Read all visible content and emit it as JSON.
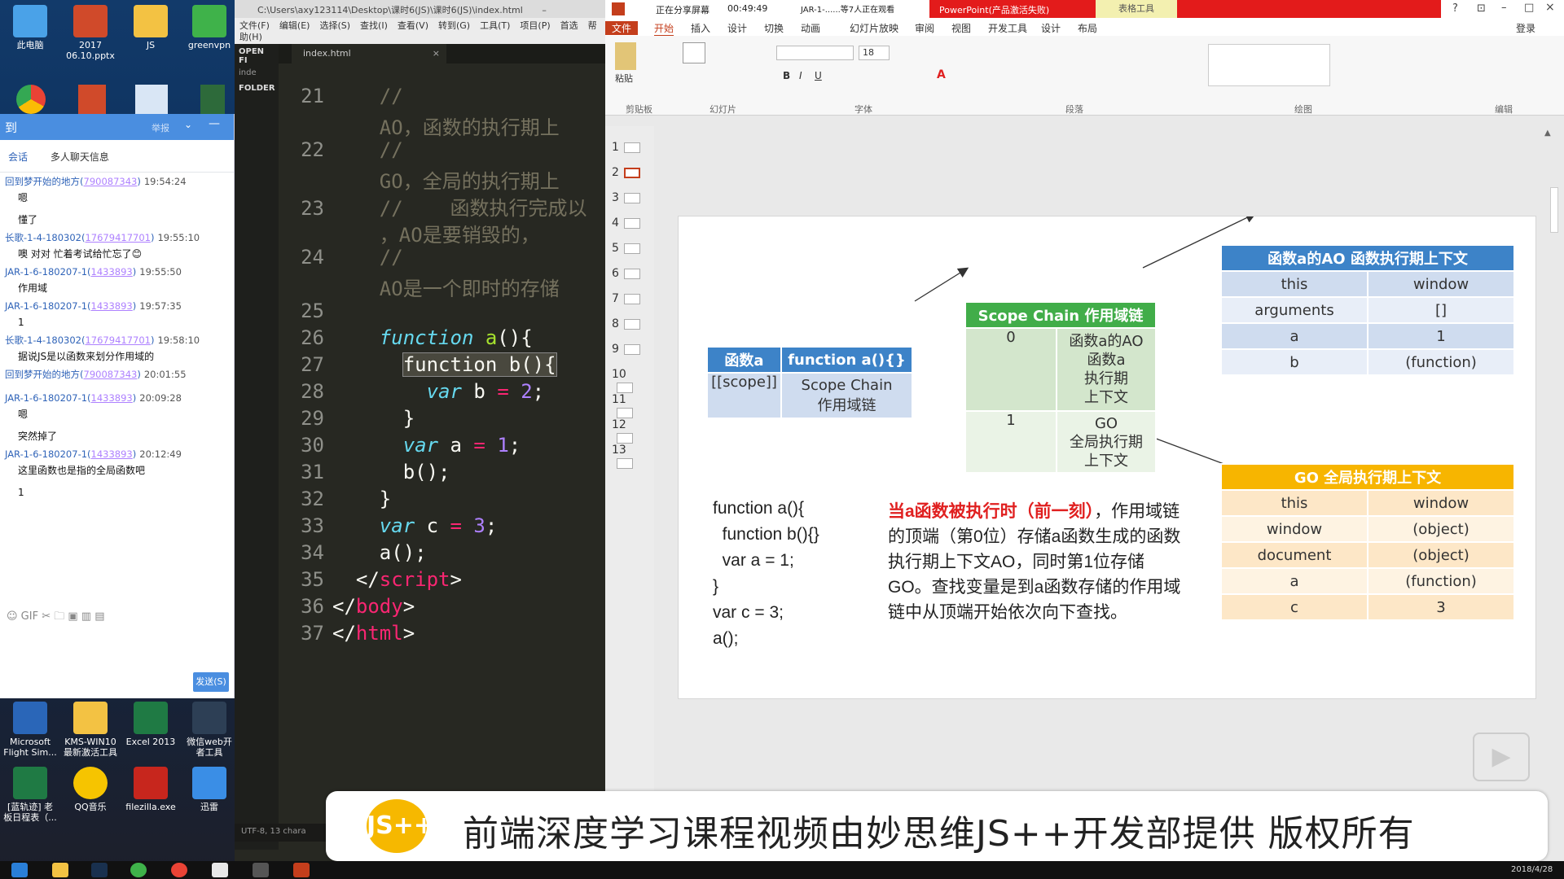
{
  "desktop": {
    "top_icons": [
      "此电脑",
      "2017\n06.10.pptx",
      "JS",
      "greenvpn"
    ],
    "bottom_icons_row1": [
      "Microsoft\nFlight Sim...",
      "KMS-WIN10\n最新激活工具",
      "Excel 2013",
      "微信web开\n者工具"
    ],
    "bottom_icons_row2": [
      "[蓝轨迹] 老\n板日程表（...",
      "QQ音乐",
      "filezilla.exe",
      "迅雷"
    ]
  },
  "chat": {
    "header_title": "到",
    "header_right": "举报",
    "tabs": [
      "会话",
      "多人聊天信息"
    ],
    "messages": [
      {
        "who": "回到梦开始的地方",
        "num": "790087343",
        "time": "19:54:24",
        "body": "嗯"
      },
      {
        "who": "",
        "num": "",
        "time": "",
        "body": "懂了"
      },
      {
        "who": "长歌-1-4-180302",
        "num": "17679417701",
        "time": "19:55:10",
        "body": "噢 对对 忙着考试给忙忘了😊"
      },
      {
        "who": "JAR-1-6-180207-1",
        "num": "1433893",
        "time": "19:55:50",
        "body": "作用域"
      },
      {
        "who": "JAR-1-6-180207-1",
        "num": "1433893",
        "time": "19:57:35",
        "body": "1"
      },
      {
        "who": "长歌-1-4-180302",
        "num": "17679417701",
        "time": "19:58:10",
        "body": "据说JS是以函数来划分作用域的"
      },
      {
        "who": "回到梦开始的地方",
        "num": "790087343",
        "time": "20:01:55",
        "body": ""
      },
      {
        "who": "JAR-1-6-180207-1",
        "num": "1433893",
        "time": "20:09:28",
        "body": "嗯"
      },
      {
        "who": "",
        "num": "",
        "time": "",
        "body": "突然掉了"
      },
      {
        "who": "JAR-1-6-180207-1",
        "num": "1433893",
        "time": "20:12:49",
        "body": "这里函数也是指的全局函数吧"
      },
      {
        "who": "",
        "num": "",
        "time": "",
        "body": "1"
      }
    ],
    "tools": "☺ GIF ✂ 🗀 ▣ ▥ ▤",
    "send_label": "发送(S)"
  },
  "editor": {
    "title": "C:\\Users\\axy123114\\Desktop\\课时6(JS)\\课时6(JS)\\index.html",
    "menu": [
      "文件(F)",
      "编辑(E)",
      "选择(S)",
      "查找(I)",
      "查看(V)",
      "转到(G)",
      "工具(T)",
      "项目(P)",
      "首选",
      "帮助(H)"
    ],
    "side_labels": [
      "OPEN FI",
      "inde",
      "FOLDER"
    ],
    "tab": "index.html",
    "status": "UTF-8, 13 chara",
    "lines": [
      {
        "n": "21",
        "html": "<span class='cmt'>    //</span>"
      },
      {
        "n": "",
        "html": "<span class='cmt'>    AO，函数的执行期上</span>"
      },
      {
        "n": "22",
        "html": "<span class='cmt'>    //</span>"
      },
      {
        "n": "",
        "html": "<span class='cmt'>    GO，全局的执行期上</span>"
      },
      {
        "n": "23",
        "html": "<span class='cmt'>    //    函数执行完成以</span>"
      },
      {
        "n": "",
        "html": "<span class='cmt'>    ，AO是要销毁的，</span>"
      },
      {
        "n": "24",
        "html": "<span class='cmt'>    //</span>"
      },
      {
        "n": "",
        "html": "<span class='cmt'>    AO是一个即时的存储</span>"
      },
      {
        "n": "25",
        "html": ""
      },
      {
        "n": "26",
        "html": "    <span class='kw'>function</span> <span class='fn'>a</span>(){"
      },
      {
        "n": "27",
        "html": "      <span class='hl'>function b(){</span>"
      },
      {
        "n": "28",
        "html": "        <span class='kw'>var</span> b <span class='op'>=</span> <span class='num'>2</span>;"
      },
      {
        "n": "29",
        "html": "      }"
      },
      {
        "n": "30",
        "html": "      <span class='kw'>var</span> a <span class='op'>=</span> <span class='num'>1</span>;"
      },
      {
        "n": "31",
        "html": "      b();"
      },
      {
        "n": "32",
        "html": "    }"
      },
      {
        "n": "33",
        "html": "    <span class='kw'>var</span> c <span class='op'>=</span> <span class='num'>3</span>;"
      },
      {
        "n": "34",
        "html": "    a();"
      },
      {
        "n": "35",
        "html": "  &lt;/<span class='tag'>script</span>&gt;"
      },
      {
        "n": "36",
        "html": "&lt;/<span class='tag'>body</span>&gt;"
      },
      {
        "n": "37",
        "html": "&lt;/<span class='tag'>html</span>&gt;"
      }
    ]
  },
  "ppt": {
    "share_status": "正在分享屏幕",
    "share_time": "00:49:49",
    "share_viewers": "JAR-1-......等7人正在观看",
    "app_title": "PowerPoint(产品激活失败)",
    "table_tools": "表格工具",
    "login": "登录",
    "tabs": [
      "文件",
      "开始",
      "插入",
      "设计",
      "切换",
      "动画",
      "幻灯片放映",
      "审阅",
      "视图",
      "开发工具",
      "设计",
      "布局"
    ],
    "ribbon_groups": [
      "剪贴板",
      "幻灯片",
      "字体",
      "段落",
      "绘图",
      "编辑"
    ],
    "font_size": "18",
    "slide_numbers": [
      "1",
      "2",
      "3",
      "4",
      "5",
      "6",
      "7",
      "8",
      "9",
      "10",
      "11",
      "12",
      "13"
    ],
    "slide": {
      "func_table": {
        "header": [
          "函数a",
          "function a(){}"
        ],
        "row": [
          "[[scope]]",
          "Scope Chain\n作用域链"
        ]
      },
      "scope_table": {
        "header": "Scope Chain 作用域链",
        "rows": [
          [
            "0",
            "函数a的AO\n函数a\n执行期\n上下文"
          ],
          [
            "1",
            "GO\n全局执行期\n上下文"
          ]
        ]
      },
      "ao_table": {
        "header": "函数a的AO 函数执行期上下文",
        "rows": [
          [
            "this",
            "window"
          ],
          [
            "arguments",
            "[]"
          ],
          [
            "a",
            "1"
          ],
          [
            "b",
            "(function)"
          ]
        ]
      },
      "go_table": {
        "header": "GO 全局执行期上下文",
        "rows": [
          [
            "this",
            "window"
          ],
          [
            "window",
            "(object)"
          ],
          [
            "document",
            "(object)"
          ],
          [
            "a",
            "(function)"
          ],
          [
            "c",
            "3"
          ]
        ]
      },
      "code": [
        "function a(){",
        "  function b(){}",
        "  var a = 1;",
        "}",
        "var c = 3;",
        "a();"
      ],
      "text_red": "当a函数被执行时（前一刻）",
      "text_body": "，作用域链的顶端（第0位）存储a函数生成的函数执行期上下文AO，同时第1位存储GO。查找变量是到a函数存储的作用域链中从顶端开始依次向下查找。"
    }
  },
  "banner": {
    "logo": "JS++",
    "text": "前端深度学习课程视频由妙思维JS++开发部提供 版权所有"
  },
  "taskbar": {
    "date": "2018/4/28"
  },
  "colors": {
    "blue": "#3d83c8",
    "green": "#41ad49",
    "gold": "#f7b500",
    "red": "#e02020"
  }
}
